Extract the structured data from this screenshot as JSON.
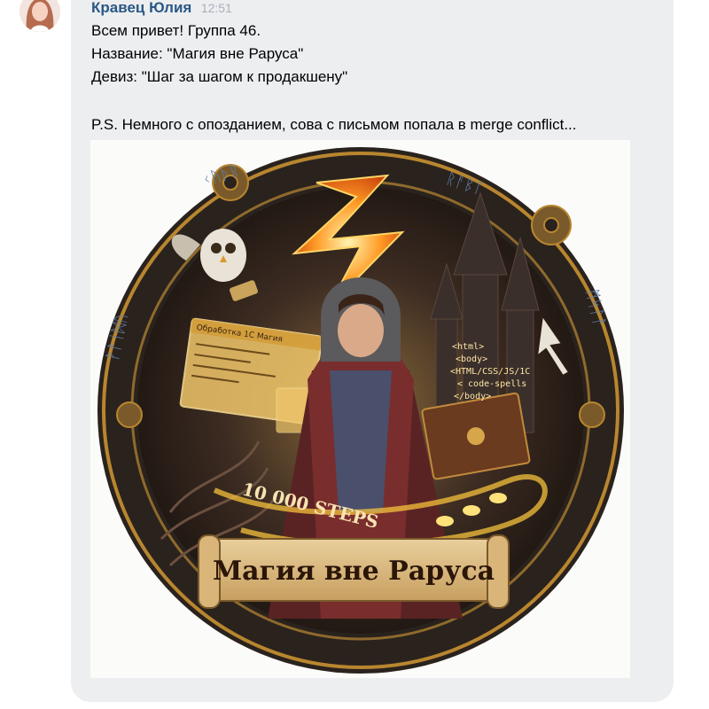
{
  "message": {
    "author": "Кравец Юлия",
    "time": "12:51",
    "lines": [
      "Всем привет! Группа 46.",
      "Название: \"Магия вне Раруса\"",
      "Девиз: \"Шаг за шагом к продакшену\""
    ],
    "ps": "P.S. Немного с опозданием, сова с письмом попала в merge conflict..."
  },
  "attachment": {
    "window_title": "Обработка 1С Магия",
    "code_tags": [
      "<html>",
      "<body>",
      "<HTML/CSS/JS/1C",
      "< code-spells",
      "</body>"
    ],
    "steps_text": "10 000 STEPS",
    "banner_text": "Магия вне Раруса",
    "runes_top_left": "ᚲᚤᚦᚱ",
    "runes_top_right": "ᚱᚨᛒᛚ",
    "runes_left": "ᚹᚨᛁᛞᚢ",
    "runes_right": "ᛗᛋᛚᚨ"
  },
  "colors": {
    "author": "#2a5885",
    "bubble": "#edeef0",
    "gold": "#b8862f",
    "dark": "#2b1d14",
    "fire": "#ff8a1e"
  }
}
